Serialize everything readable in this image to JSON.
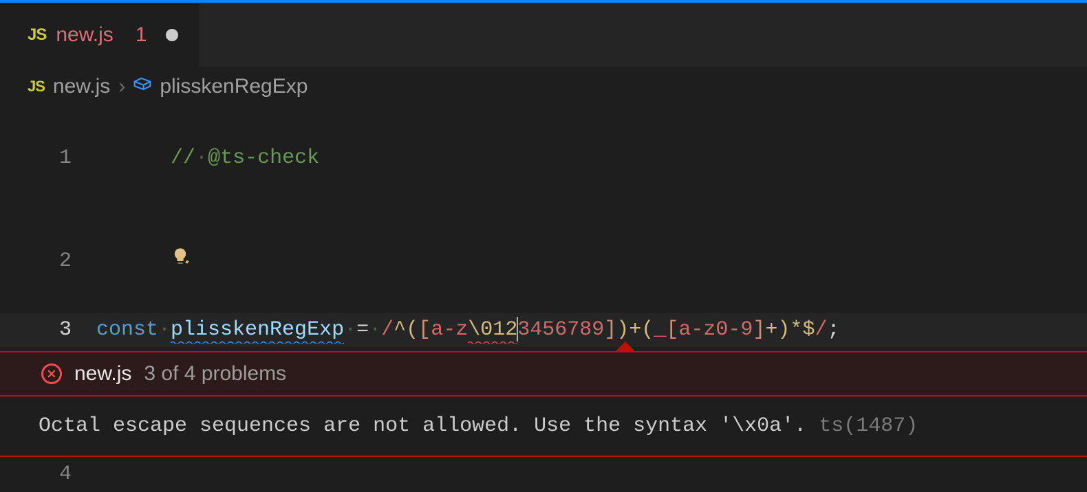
{
  "tab": {
    "js_label": "JS",
    "filename": "new.js",
    "problem_count": "1"
  },
  "breadcrumb": {
    "js_label": "JS",
    "filename": "new.js",
    "separator": "›",
    "symbol": "plisskenRegExp"
  },
  "lines": {
    "l1": {
      "num": "1",
      "comment_prefix": "//",
      "dot": "·",
      "comment_text": "@ts-check"
    },
    "l2": {
      "num": "2"
    },
    "l3": {
      "num": "3",
      "kw": "const",
      "dot": "·",
      "name": "plisskenRegExp",
      "eq": "=",
      "r_open": "/",
      "r_anchor1": "^",
      "r_p1": "(",
      "r_b1": "[",
      "r_cls1": "a-z",
      "r_esc_pre": "\\012",
      "r_esc_post": "3456789",
      "r_b1c": "]",
      "r_p1c": ")",
      "r_q1": "+",
      "r_p2": "(",
      "r_und": "_",
      "r_b2": "[",
      "r_cls2": "a-z0-9",
      "r_b2c": "]",
      "r_q2": "+",
      "r_p2c": ")",
      "r_q3": "*",
      "r_anchor2": "$",
      "r_close": "/",
      "semi": ";"
    },
    "l4": {
      "num": "4"
    }
  },
  "problem": {
    "file": "new.js",
    "count_text": "3 of 4 problems",
    "message": "Octal escape sequences are not allowed. Use the syntax '\\x0a'.",
    "code": "ts(1487)"
  }
}
